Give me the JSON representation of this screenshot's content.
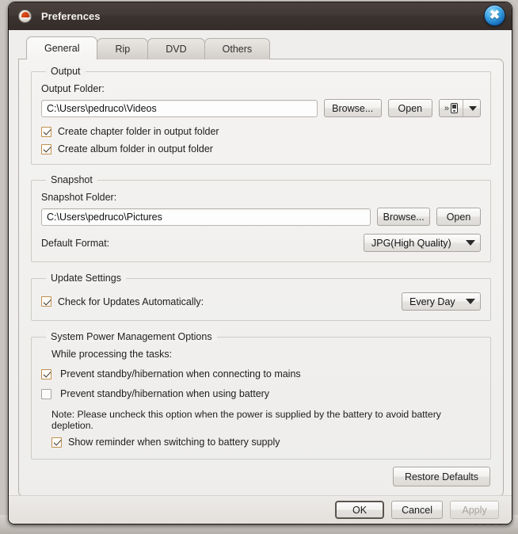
{
  "window": {
    "title": "Preferences",
    "app_icon": "app-logo-icon",
    "close_icon": "close-icon"
  },
  "tabs": [
    {
      "label": "General",
      "active": true
    },
    {
      "label": "Rip",
      "active": false
    },
    {
      "label": "DVD",
      "active": false
    },
    {
      "label": "Others",
      "active": false
    }
  ],
  "output": {
    "legend": "Output",
    "folder_label": "Output Folder:",
    "folder_value": "C:\\Users\\pedruco\\Videos",
    "browse_label": "Browse...",
    "open_label": "Open",
    "device_button": {
      "chevron": "»",
      "icon": "portable-device-icon",
      "dropdown_icon": "chevron-down-icon"
    },
    "checkboxes": [
      {
        "label": "Create chapter folder in output folder",
        "checked": true
      },
      {
        "label": "Create album folder in output folder",
        "checked": true
      }
    ]
  },
  "snapshot": {
    "legend": "Snapshot",
    "folder_label": "Snapshot Folder:",
    "folder_value": "C:\\Users\\pedruco\\Pictures",
    "browse_label": "Browse...",
    "open_label": "Open",
    "format_label": "Default Format:",
    "format_value": "JPG(High Quality)"
  },
  "update": {
    "legend": "Update Settings",
    "check_label": "Check for Updates Automatically:",
    "check_checked": true,
    "frequency_value": "Every Day"
  },
  "power": {
    "legend": "System Power Management Options",
    "sub_label": "While processing the tasks:",
    "option_mains": "Prevent standby/hibernation when connecting to mains",
    "option_mains_checked": true,
    "option_battery": "Prevent standby/hibernation when using battery",
    "option_battery_checked": false,
    "note": "Note: Please uncheck this option when the power is supplied by the battery to avoid battery depletion.",
    "reminder_label": "Show reminder when switching to battery supply",
    "reminder_checked": true
  },
  "footer": {
    "restore_label": "Restore Defaults",
    "ok_label": "OK",
    "cancel_label": "Cancel",
    "apply_label": "Apply",
    "apply_disabled": true
  },
  "colors": {
    "titlebar": "#3a322e",
    "close_button": "#1464b4",
    "checkbox_border": "#c09050",
    "panel_bg": "#f2f1ef"
  }
}
